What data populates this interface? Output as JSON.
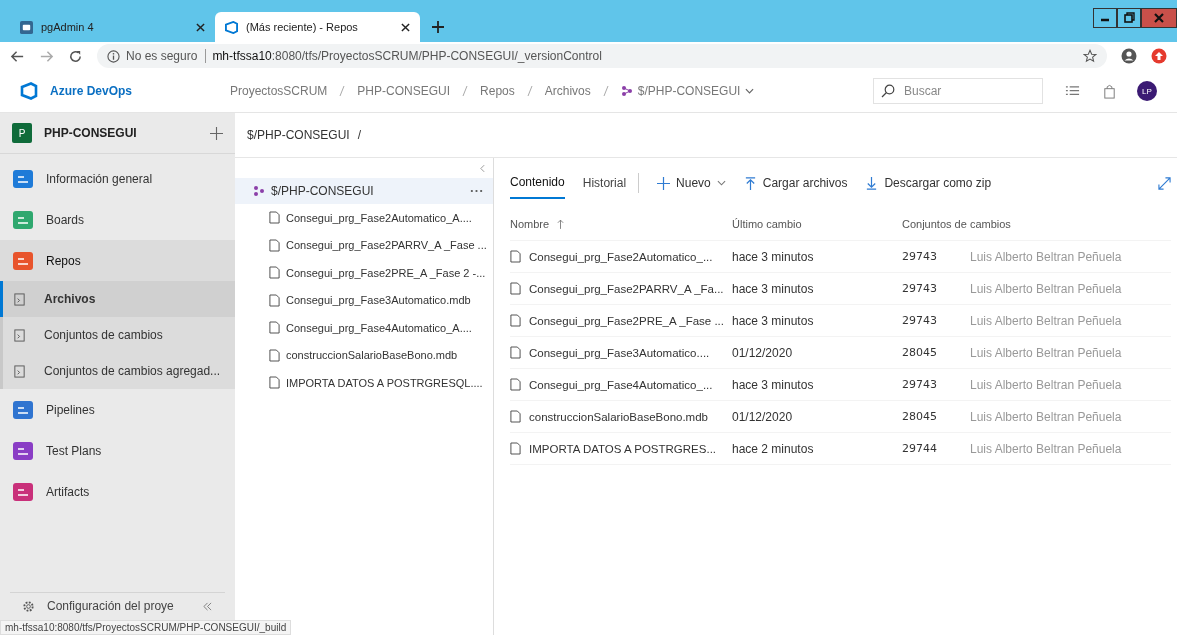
{
  "browser": {
    "tabs": [
      {
        "title": "pgAdmin 4",
        "selected": false,
        "kind": "pg"
      },
      {
        "title": "(Más reciente) - Repos",
        "selected": true,
        "kind": "azure"
      }
    ],
    "security": "No es seguro",
    "url_host": "mh-tfssa10",
    "url_rest": ":8080/tfs/ProyectosSCRUM/PHP-CONSEGUI/_versionControl"
  },
  "header": {
    "brand": "Azure DevOps",
    "breadcrumbs": [
      "ProyectosSCRUM",
      "PHP-CONSEGUI",
      "Repos",
      "Archivos"
    ],
    "repo": "$/PHP-CONSEGUI",
    "search": {
      "placeholder": "Buscar"
    },
    "avatar": "LP"
  },
  "sidebar": {
    "project_initial": "P",
    "project": "PHP-CONSEGUI",
    "items": [
      {
        "label": "Información general",
        "selected": false
      },
      {
        "label": "Boards",
        "selected": false
      },
      {
        "label": "Repos",
        "selected": true,
        "children": [
          {
            "label": "Archivos",
            "selected": true
          },
          {
            "label": "Conjuntos de cambios",
            "selected": false
          },
          {
            "label": "Conjuntos de cambios agregad...",
            "selected": false
          }
        ]
      },
      {
        "label": "Pipelines",
        "selected": false
      },
      {
        "label": "Test Plans",
        "selected": false
      },
      {
        "label": "Artifacts",
        "selected": false
      }
    ],
    "settings": "Configuración del proye"
  },
  "path": "$/PHP-CONSEGUI",
  "path_sep": "/",
  "tree": {
    "root": "$/PHP-CONSEGUI",
    "files": [
      "Consegui_prg_Fase2Automatico_A....",
      "Consegui_prg_Fase2PARRV_A _Fase ...",
      "Consegui_prg_Fase2PRE_A _Fase 2 -...",
      "Consegui_prg_Fase3Automatico.mdb",
      "Consegui_prg_Fase4Automatico_A....",
      "construccionSalarioBaseBono.mdb",
      "IMPORTA DATOS A POSTRGRESQL...."
    ]
  },
  "content": {
    "tabs": [
      {
        "label": "Contenido",
        "selected": true
      },
      {
        "label": "Historial",
        "selected": false
      }
    ],
    "actions": [
      "Nuevo",
      "Cargar archivos",
      "Descargar como zip"
    ],
    "columns": [
      "Nombre",
      "Último cambio",
      "Conjuntos de cambios"
    ],
    "rows": [
      {
        "name": "Consegui_prg_Fase2Automatico_...",
        "changed": "hace 3 minutos",
        "changeset": "29743",
        "author": "Luis Alberto Beltran Peñuela"
      },
      {
        "name": "Consegui_prg_Fase2PARRV_A _Fa...",
        "changed": "hace 3 minutos",
        "changeset": "29743",
        "author": "Luis Alberto Beltran Peñuela"
      },
      {
        "name": "Consegui_prg_Fase2PRE_A _Fase ...",
        "changed": "hace 3 minutos",
        "changeset": "29743",
        "author": "Luis Alberto Beltran Peñuela"
      },
      {
        "name": "Consegui_prg_Fase3Automatico....",
        "changed": "01/12/2020",
        "changeset": "28045",
        "author": "Luis Alberto Beltran Peñuela"
      },
      {
        "name": "Consegui_prg_Fase4Automatico_...",
        "changed": "hace 3 minutos",
        "changeset": "29743",
        "author": "Luis Alberto Beltran Peñuela"
      },
      {
        "name": "construccionSalarioBaseBono.mdb",
        "changed": "01/12/2020",
        "changeset": "28045",
        "author": "Luis Alberto Beltran Peñuela"
      },
      {
        "name": "IMPORTA DATOS A POSTRGRES...",
        "changed": "hace 2 minutos",
        "changeset": "29744",
        "author": "Luis Alberto Beltran Peñuela"
      }
    ]
  },
  "status_url": "mh-tfssa10:8080/tfs/ProyectosSCRUM/PHP-CONSEGUI/_build"
}
